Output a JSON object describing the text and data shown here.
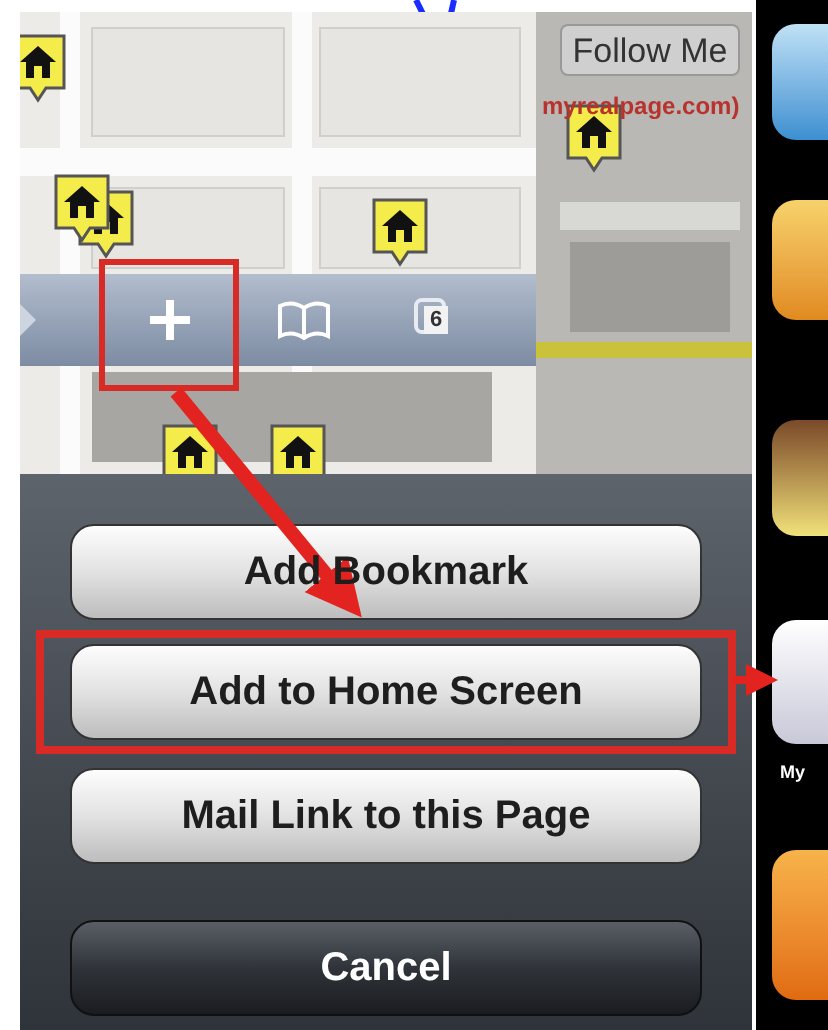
{
  "map": {
    "follow_button": "Follow Me",
    "site_label": "myrealpage.com)"
  },
  "toolbar": {
    "tabs_count": "6"
  },
  "action_sheet": {
    "buttons": [
      {
        "label": "Add Bookmark",
        "kind": "default",
        "highlighted": false
      },
      {
        "label": "Add to Home Screen",
        "kind": "default",
        "highlighted": true
      },
      {
        "label": "Mail Link to this Page",
        "kind": "default",
        "highlighted": false
      },
      {
        "label": "Cancel",
        "kind": "cancel",
        "highlighted": false
      }
    ]
  },
  "home_screen": {
    "app_label": "My"
  }
}
